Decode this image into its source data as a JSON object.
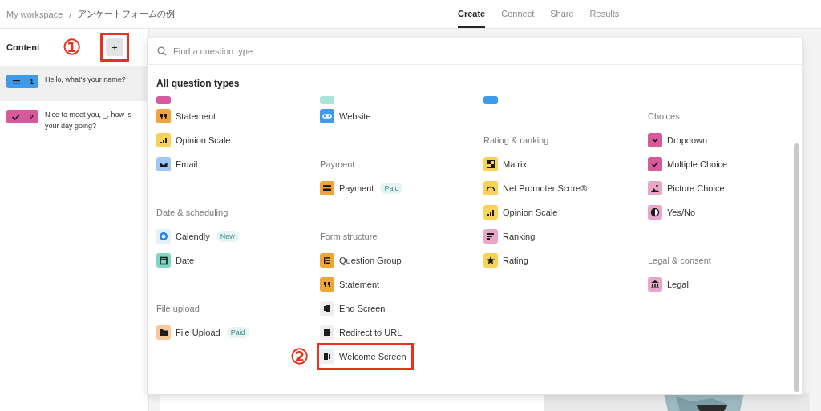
{
  "breadcrumb": {
    "workspace": "My workspace",
    "separator": "/",
    "form": "アンケートフォームの例"
  },
  "tabs": [
    {
      "label": "Create",
      "selected": true
    },
    {
      "label": "Connect",
      "selected": false
    },
    {
      "label": "Share",
      "selected": false
    },
    {
      "label": "Results",
      "selected": false
    }
  ],
  "sidebar": {
    "title": "Content",
    "add_button": {
      "label": "+",
      "callout": "①"
    },
    "items": [
      {
        "number": "1",
        "label": "Hello, what's your name?",
        "color": "#3d9be9",
        "selected": true
      },
      {
        "number": "2",
        "label": "Nice to meet you, _, how is your day going?",
        "color": "#d65a9b",
        "selected": false
      }
    ]
  },
  "popover": {
    "search": {
      "placeholder": "Find a question type"
    },
    "title": "All question types",
    "columns": [
      [
        {
          "kind": "cut",
          "color": "#d65a9b"
        },
        {
          "kind": "item",
          "color": "#f0a43c",
          "label": "Statement"
        },
        {
          "kind": "item",
          "color": "#f7d35a",
          "label": "Opinion Scale"
        },
        {
          "kind": "item",
          "color": "#9fc8f0",
          "label": "Email"
        },
        {
          "kind": "gap"
        },
        {
          "kind": "heading",
          "label": "Date & scheduling"
        },
        {
          "kind": "item",
          "color": "#e4f0fb",
          "label": "Calendly",
          "badge": "New"
        },
        {
          "kind": "item",
          "color": "#7fd6c4",
          "label": "Date"
        },
        {
          "kind": "gap"
        },
        {
          "kind": "heading",
          "label": "File upload"
        },
        {
          "kind": "item",
          "color": "#f7c99a",
          "label": "File Upload",
          "badge": "Paid"
        }
      ],
      [
        {
          "kind": "cut",
          "color": "#a9e3da"
        },
        {
          "kind": "item",
          "color": "#3d9be9",
          "label": "Website"
        },
        {
          "kind": "gap"
        },
        {
          "kind": "heading",
          "label": "Payment"
        },
        {
          "kind": "item",
          "color": "#f0a43c",
          "label": "Payment",
          "badge": "Paid"
        },
        {
          "kind": "gap"
        },
        {
          "kind": "heading",
          "label": "Form structure"
        },
        {
          "kind": "item",
          "color": "#f0a43c",
          "label": "Question Group"
        },
        {
          "kind": "item",
          "color": "#f0a43c",
          "label": "Statement"
        },
        {
          "kind": "item",
          "color": "#eeeeee",
          "label": "End Screen"
        },
        {
          "kind": "item",
          "color": "#eeeeee",
          "label": "Redirect to URL"
        },
        {
          "kind": "item",
          "color": "#eeeeee",
          "label": "Welcome Screen",
          "callout": "②"
        }
      ],
      [
        {
          "kind": "cut",
          "color": "#3d9be9"
        },
        {
          "kind": "gap"
        },
        {
          "kind": "heading",
          "label": "Rating & ranking"
        },
        {
          "kind": "item",
          "color": "#f7d35a",
          "label": "Matrix"
        },
        {
          "kind": "item",
          "color": "#f7d35a",
          "label": "Net Promoter Score®"
        },
        {
          "kind": "item",
          "color": "#f7d35a",
          "label": "Opinion Scale"
        },
        {
          "kind": "item",
          "color": "#e8a6c8",
          "label": "Ranking"
        },
        {
          "kind": "item",
          "color": "#f7d35a",
          "label": "Rating"
        }
      ],
      [
        {
          "kind": "gap"
        },
        {
          "kind": "heading",
          "label": "Choices"
        },
        {
          "kind": "item",
          "color": "#d65a9b",
          "label": "Dropdown"
        },
        {
          "kind": "item",
          "color": "#d65a9b",
          "label": "Multiple Choice"
        },
        {
          "kind": "item",
          "color": "#e8a6c8",
          "label": "Picture Choice"
        },
        {
          "kind": "item",
          "color": "#e8a6c8",
          "label": "Yes/No"
        },
        {
          "kind": "gap"
        },
        {
          "kind": "heading",
          "label": "Legal & consent"
        },
        {
          "kind": "item",
          "color": "#e8a6c8",
          "label": "Legal"
        }
      ]
    ]
  }
}
